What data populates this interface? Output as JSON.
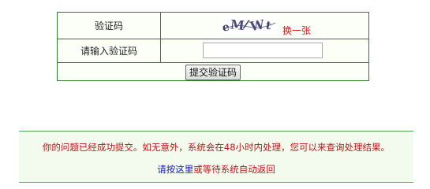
{
  "form": {
    "captcha_label": "验证码",
    "captcha_image_text": "eM/Wt",
    "refresh_label": "换一张",
    "input_label": "请输入验证码",
    "input_value": "",
    "submit_label": "提交验证码"
  },
  "notice": {
    "message": "你的问题已经成功提交。如无意外，系统会在48小时内处理，您可以来查询处理结果。",
    "back_link": "请按这里",
    "or_text": "或等待系统自动返回"
  },
  "colors": {
    "border": "#2f7a2f",
    "notice_bg": "#f2fbee",
    "message_red": "#c0161a",
    "link_blue": "#1a1ab4"
  }
}
